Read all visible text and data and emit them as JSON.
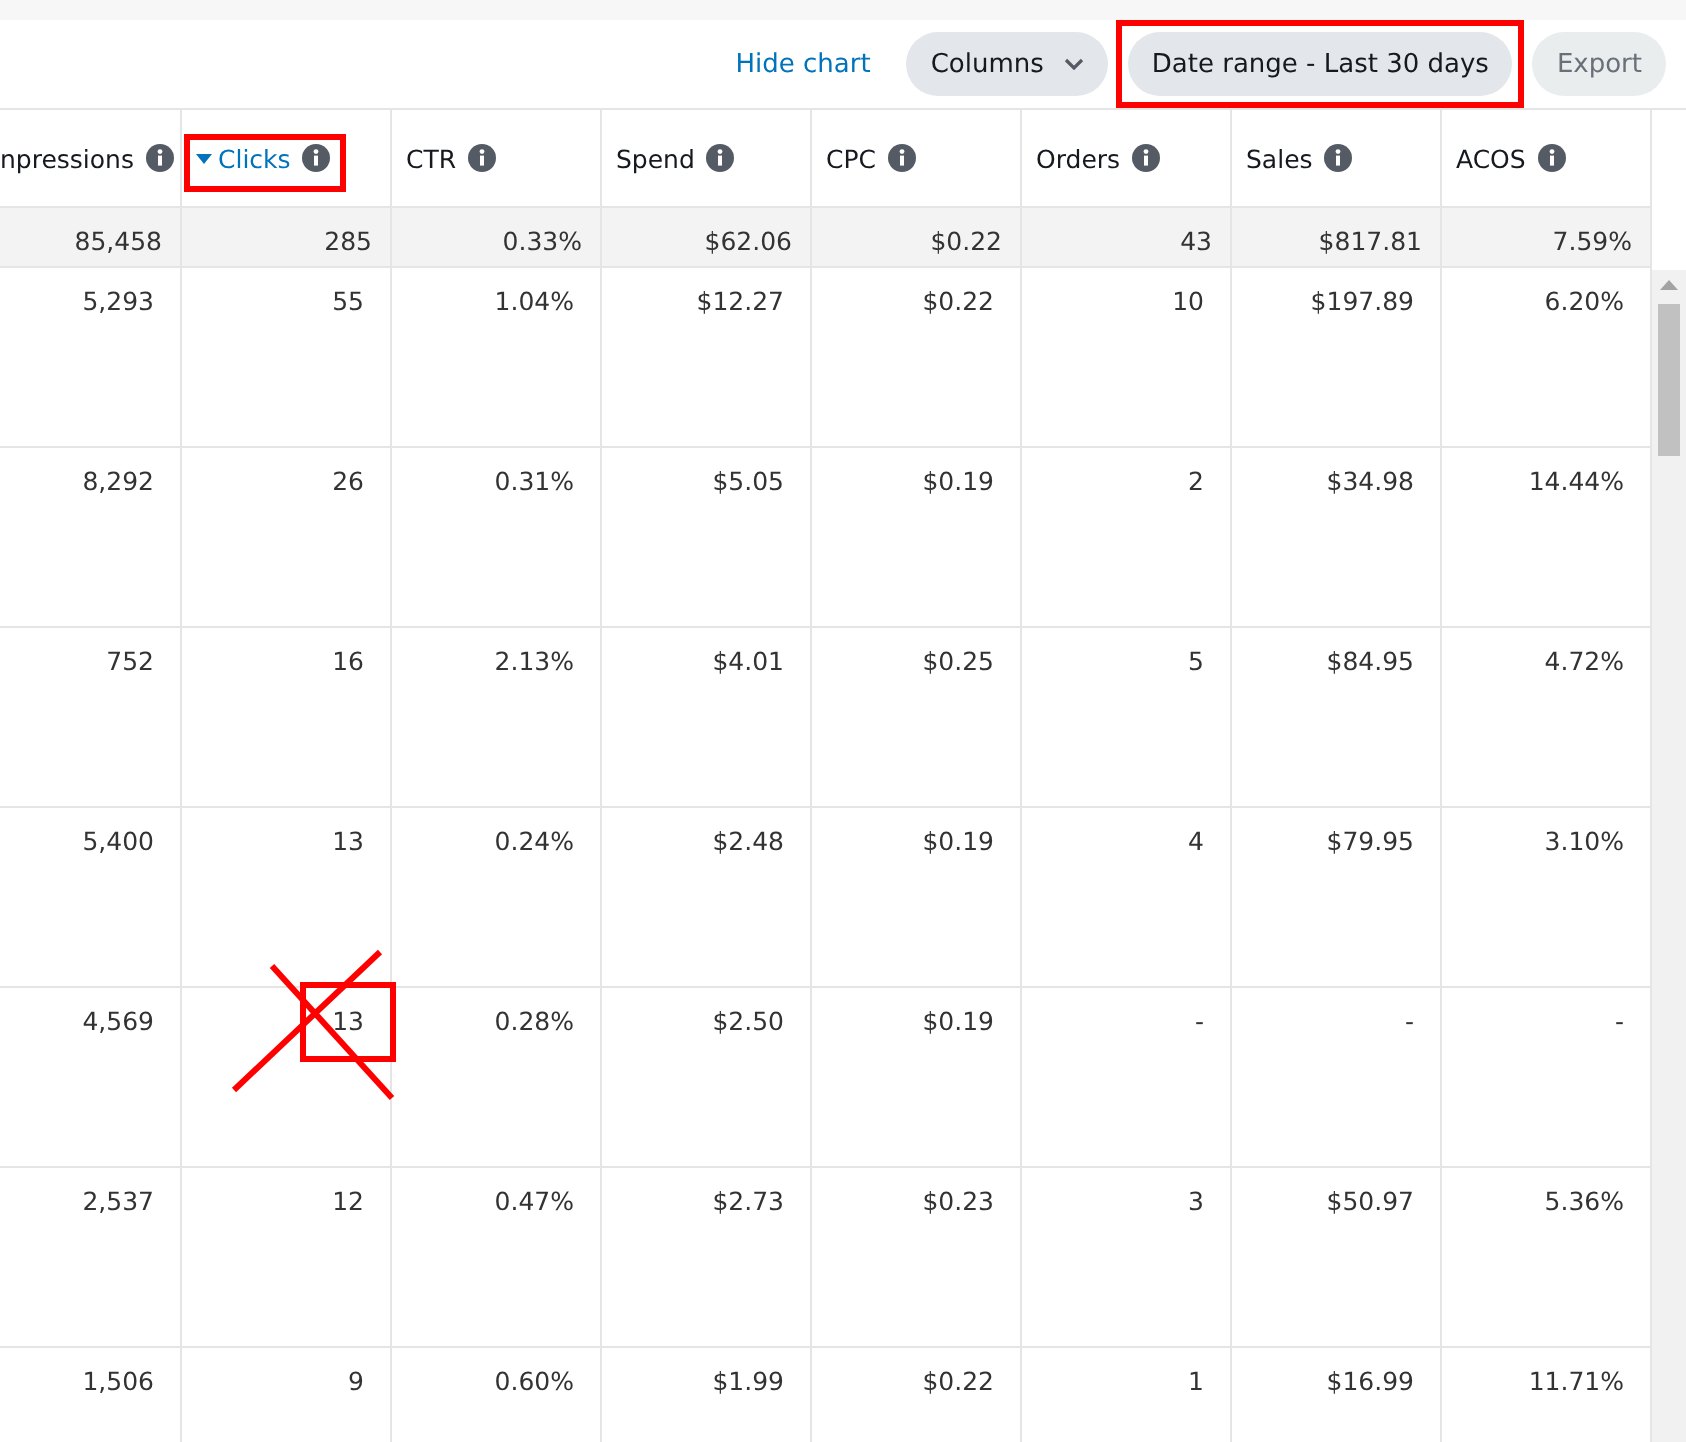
{
  "toolbar": {
    "link": "Hide chart",
    "buttons": [
      {
        "label": "Columns",
        "kind": "dropdown",
        "highlighted": false
      },
      {
        "label": "Date range - Last 30 days",
        "kind": "plain",
        "highlighted": true
      },
      {
        "label": "Export",
        "kind": "disabled",
        "highlighted": false
      }
    ]
  },
  "table": {
    "columns": [
      {
        "label": "npressions",
        "sorted": false,
        "highlighted": false
      },
      {
        "label": "Clicks",
        "sorted": true,
        "highlighted": true
      },
      {
        "label": "CTR",
        "sorted": false,
        "highlighted": false
      },
      {
        "label": "Spend",
        "sorted": false,
        "highlighted": false
      },
      {
        "label": "CPC",
        "sorted": false,
        "highlighted": false
      },
      {
        "label": "Orders",
        "sorted": false,
        "highlighted": false
      },
      {
        "label": "Sales",
        "sorted": false,
        "highlighted": false
      },
      {
        "label": "ACOS",
        "sorted": false,
        "highlighted": false
      }
    ],
    "totals": [
      "85,458",
      "285",
      "0.33%",
      "$62.06",
      "$0.22",
      "43",
      "$817.81",
      "7.59%"
    ],
    "rows": [
      {
        "cells": [
          "5,293",
          "55",
          "1.04%",
          "$12.27",
          "$0.22",
          "10",
          "$197.89",
          "6.20%"
        ]
      },
      {
        "cells": [
          "8,292",
          "26",
          "0.31%",
          "$5.05",
          "$0.19",
          "2",
          "$34.98",
          "14.44%"
        ]
      },
      {
        "cells": [
          "752",
          "16",
          "2.13%",
          "$4.01",
          "$0.25",
          "5",
          "$84.95",
          "4.72%"
        ]
      },
      {
        "cells": [
          "5,400",
          "13",
          "0.24%",
          "$2.48",
          "$0.19",
          "4",
          "$79.95",
          "3.10%"
        ]
      },
      {
        "cells": [
          "4,569",
          "13",
          "0.28%",
          "$2.50",
          "$0.19",
          "-",
          "-",
          "-"
        ],
        "crossed": [
          false,
          true,
          false,
          false,
          false,
          false,
          false,
          false
        ]
      },
      {
        "cells": [
          "2,537",
          "12",
          "0.47%",
          "$2.73",
          "$0.23",
          "3",
          "$50.97",
          "5.36%"
        ]
      },
      {
        "cells": [
          "1,506",
          "9",
          "0.60%",
          "$1.99",
          "$0.22",
          "1",
          "$16.99",
          "11.71%"
        ]
      }
    ]
  }
}
